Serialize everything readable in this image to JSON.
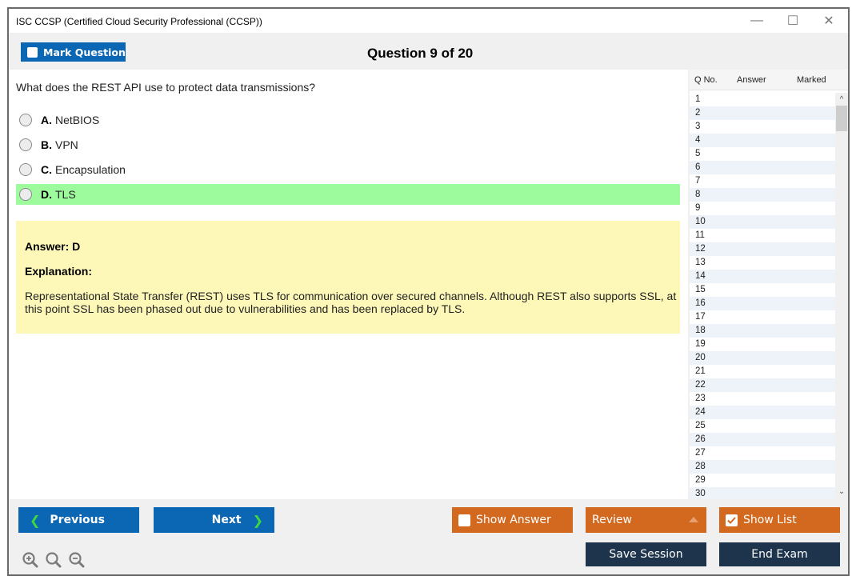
{
  "window": {
    "title": "ISC CCSP (Certified Cloud Security Professional (CCSP))",
    "controls": {
      "minimize": "—",
      "maximize": "☐",
      "close": "✕"
    }
  },
  "toolbar": {
    "mark_question_label": "Mark Question",
    "question_counter": "Question 9 of 20"
  },
  "question": {
    "text": "What does the REST API use to protect data transmissions?",
    "options": [
      {
        "letter": "A.",
        "text": "NetBIOS",
        "correct": false
      },
      {
        "letter": "B.",
        "text": "VPN",
        "correct": false
      },
      {
        "letter": "C.",
        "text": "Encapsulation",
        "correct": false
      },
      {
        "letter": "D.",
        "text": "TLS",
        "correct": true
      }
    ]
  },
  "answer": {
    "answer_line": "Answer: D",
    "explanation_heading": "Explanation:",
    "explanation_text": "Representational State Transfer (REST) uses TLS for communication over secured channels. Although REST also supports SSL, at this point SSL has been phased out due to vulnerabilities and has been replaced by TLS.",
    "highlight_color": "#9dfa9d",
    "box_color": "#fdf8b8"
  },
  "question_list": {
    "headers": {
      "qno": "Q No.",
      "answer": "Answer",
      "marked": "Marked"
    },
    "rows": [
      "1",
      "2",
      "3",
      "4",
      "5",
      "6",
      "7",
      "8",
      "9",
      "10",
      "11",
      "12",
      "13",
      "14",
      "15",
      "16",
      "17",
      "18",
      "19",
      "20",
      "21",
      "22",
      "23",
      "24",
      "25",
      "26",
      "27",
      "28",
      "29",
      "30"
    ]
  },
  "footer": {
    "previous_label": "Previous",
    "next_label": "Next",
    "show_answer_label": "Show Answer",
    "show_answer_checked": false,
    "review_label": "Review",
    "show_list_label": "Show List",
    "show_list_checked": true,
    "save_session_label": "Save Session",
    "end_exam_label": "End Exam"
  },
  "colors": {
    "primary_blue": "#0b66b4",
    "orange": "#d2691e",
    "navy": "#1e344c",
    "chevron_green": "#3ed63e"
  }
}
